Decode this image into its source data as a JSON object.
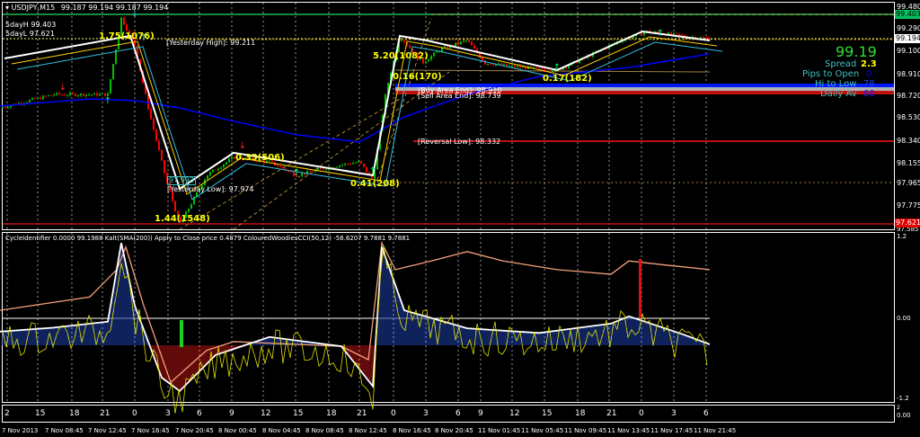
{
  "header": {
    "symbol": "USDJPY,M15",
    "ohlc": "99.187 99.194 99.187 99.194",
    "day_high": "5dayH 99.403",
    "day_low": "5dayL 97.621"
  },
  "price_axis": [
    "99.480",
    "99.290",
    "99.100",
    "98.910",
    "98.720",
    "98.530",
    "98.340",
    "98.155",
    "97.965",
    "97.775",
    "97.585"
  ],
  "price_boxes": {
    "green": "99.403",
    "white": "99.194",
    "red": "97.621"
  },
  "info": {
    "price": "99.19",
    "spread_label": "Spread",
    "spread": "2.3",
    "pips_open_label": "Pips to Open",
    "pips_open": "0",
    "hi_low_label": "Hi to Low",
    "hi_low": "78",
    "daily_av_label": "Daily Av",
    "daily_av": "88"
  },
  "annotations": {
    "swing1": "1.75(1076)",
    "swing2": "1.44(1548)",
    "swing3": "0.33(506)",
    "swing4": "0.41(208)",
    "swing5": "5.20(1082)",
    "swing6": "0.16(170)",
    "swing7": "0.17(182)",
    "yesterday_high": "[Yesterday High]: 99.211",
    "yesterday_low": "[Yesterday Low]: 97.974",
    "low_box": "97.993",
    "buy_area": "[Buy Area End]: 98.910",
    "sell_area": "[Sell Area End]: 98.739",
    "reversal_low": "[Reversal Low]: 98.332"
  },
  "indicator": {
    "title": "CycleIdentifier 0.0000 99.1988  Kalt(SMA(200)) Apply to Close price 0.4879  ColouredWoodiesCCI(50,12) -58.6207 9.7881 9.7881",
    "axis": [
      "1.2",
      "0.00",
      "-1.2"
    ]
  },
  "sub_panel": {
    "axis_top": "2",
    "axis_bottom": "0.00"
  },
  "hours": [
    "2",
    "15",
    "18",
    "21",
    "0",
    "3",
    "6",
    "9",
    "12",
    "15",
    "18",
    "21",
    "0",
    "3",
    "6",
    "9",
    "12",
    "15",
    "18",
    "21",
    "0",
    "3",
    "6"
  ],
  "dates": [
    "7 Nov 2013",
    "7 Nov 08:45",
    "7 Nov 12:45",
    "7 Nov 16:45",
    "7 Nov 20:45",
    "8 Nov 00:45",
    "8 Nov 04:45",
    "8 Nov 08:45",
    "8 Nov 12:45",
    "8 Nov 16:45",
    "8 Nov 20:45",
    "11 Nov 01:45",
    "11 Nov 05:45",
    "11 Nov 09:45",
    "11 Nov 13:45",
    "11 Nov 17:45",
    "11 Nov 21:45"
  ],
  "chart_data": {
    "type": "line",
    "price_path": [
      [
        0,
        98.609
      ],
      [
        60,
        98.724
      ],
      [
        120,
        98.724
      ],
      [
        135,
        99.38
      ],
      [
        150,
        99.149
      ],
      [
        165,
        98.609
      ],
      [
        185,
        97.992
      ],
      [
        200,
        97.607
      ],
      [
        230,
        98.031
      ],
      [
        260,
        98.185
      ],
      [
        300,
        98.146
      ],
      [
        330,
        98.031
      ],
      [
        370,
        98.108
      ],
      [
        400,
        98.146
      ],
      [
        415,
        97.992
      ],
      [
        430,
        98.763
      ],
      [
        445,
        99.226
      ],
      [
        470,
        98.994
      ],
      [
        490,
        99.11
      ],
      [
        520,
        99.187
      ],
      [
        540,
        98.994
      ],
      [
        580,
        98.956
      ],
      [
        620,
        98.933
      ],
      [
        650,
        99.033
      ],
      [
        690,
        99.187
      ],
      [
        720,
        99.264
      ],
      [
        760,
        99.226
      ],
      [
        790,
        99.202
      ]
    ],
    "ma_path": [
      [
        0,
        98.625
      ],
      [
        100,
        98.686
      ],
      [
        150,
        98.671
      ],
      [
        200,
        98.609
      ],
      [
        260,
        98.494
      ],
      [
        330,
        98.378
      ],
      [
        400,
        98.316
      ],
      [
        450,
        98.532
      ],
      [
        520,
        98.724
      ],
      [
        600,
        98.879
      ],
      [
        700,
        98.956
      ],
      [
        790,
        99.072
      ]
    ],
    "zigzag": [
      [
        5,
        99.033
      ],
      [
        145,
        99.226
      ],
      [
        200,
        97.915
      ],
      [
        260,
        98.224
      ],
      [
        415,
        98.031
      ],
      [
        445,
        99.226
      ],
      [
        475,
        99.187
      ],
      [
        620,
        98.933
      ],
      [
        715,
        99.264
      ],
      [
        790,
        99.187
      ]
    ],
    "cycle_white": [
      [
        0,
        -0.2
      ],
      [
        60,
        -0.14
      ],
      [
        120,
        -0.05
      ],
      [
        135,
        1.13
      ],
      [
        150,
        0.19
      ],
      [
        180,
        -0.89
      ],
      [
        200,
        -1.09
      ],
      [
        240,
        -0.55
      ],
      [
        300,
        -0.28
      ],
      [
        380,
        -0.42
      ],
      [
        415,
        -1.02
      ],
      [
        425,
        1.07
      ],
      [
        450,
        0.12
      ],
      [
        520,
        -0.15
      ],
      [
        600,
        -0.22
      ],
      [
        680,
        -0.08
      ],
      [
        700,
        0.03
      ],
      [
        760,
        -0.24
      ],
      [
        790,
        -0.39
      ]
    ],
    "cycle_salmon": [
      [
        0,
        0.12
      ],
      [
        100,
        0.32
      ],
      [
        130,
        0.73
      ],
      [
        140,
        1.07
      ],
      [
        160,
        0.19
      ],
      [
        190,
        -0.96
      ],
      [
        230,
        -0.48
      ],
      [
        260,
        -0.35
      ],
      [
        380,
        -0.42
      ],
      [
        410,
        -0.62
      ],
      [
        425,
        1.13
      ],
      [
        440,
        0.73
      ],
      [
        480,
        0.86
      ],
      [
        520,
        1.0
      ],
      [
        560,
        0.86
      ],
      [
        620,
        0.73
      ],
      [
        680,
        0.66
      ],
      [
        700,
        0.86
      ],
      [
        740,
        0.8
      ],
      [
        790,
        0.73
      ]
    ],
    "y_range_main": [
      97.585,
      99.48
    ],
    "y_range_ind": [
      -1.2,
      1.2
    ]
  },
  "colors": {
    "up": "#00c000",
    "down": "#ff0000",
    "ma": "#0000ff",
    "grid": "#c0c0c0",
    "label": "#ffff00",
    "salmon": "#f4a07a",
    "hist_up": "#1a3a9a",
    "hist_down": "#a01010"
  }
}
